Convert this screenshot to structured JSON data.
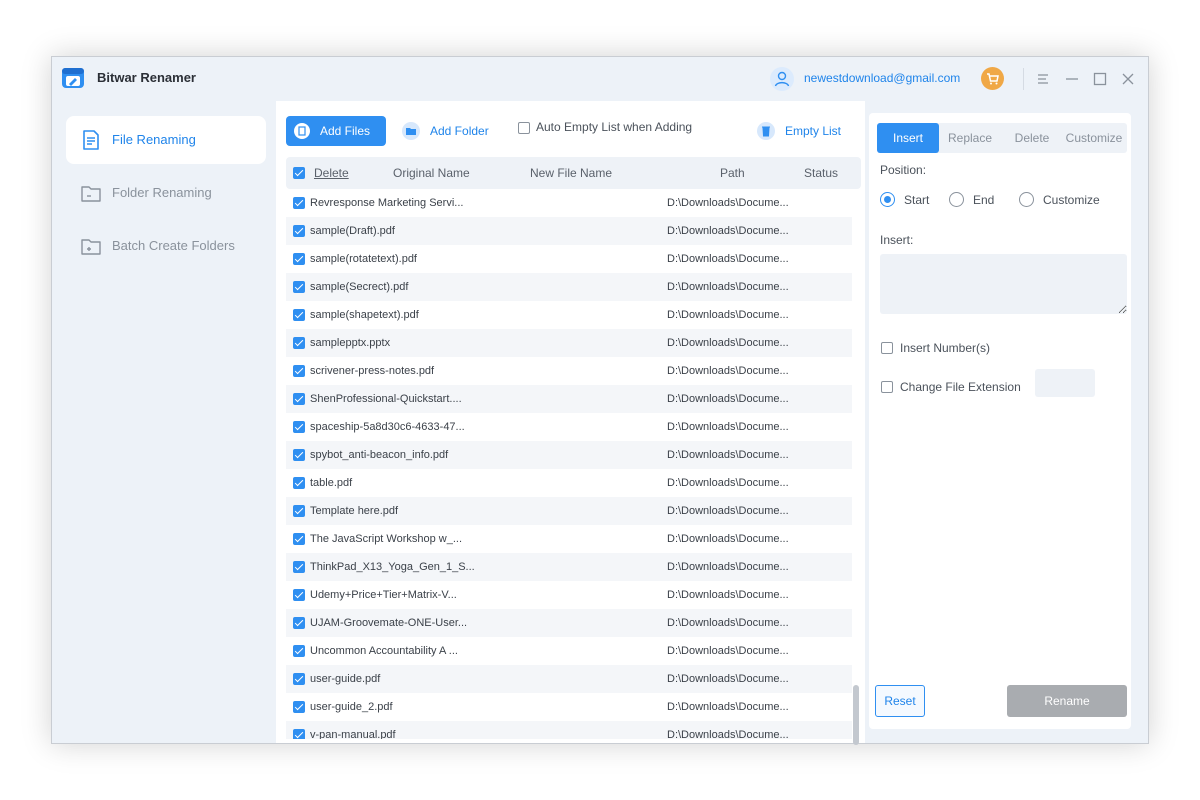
{
  "app": {
    "title": "Bitwar Renamer",
    "user_email": "newestdownload@gmail.com"
  },
  "sidebar": {
    "items": [
      {
        "label": "File Renaming",
        "active": true,
        "icon": "file-icon"
      },
      {
        "label": "Folder Renaming",
        "active": false,
        "icon": "folder-icon"
      },
      {
        "label": "Batch Create Folders",
        "active": false,
        "icon": "folder-plus-icon"
      }
    ]
  },
  "toolbar": {
    "add_files": "Add Files",
    "add_folder": "Add Folder",
    "auto_empty": "Auto Empty List when Adding",
    "auto_empty_checked": false,
    "empty_list": "Empty List"
  },
  "table": {
    "columns": {
      "delete": "Delete",
      "original": "Original Name",
      "new": "New File Name",
      "path": "Path",
      "status": "Status"
    },
    "rows": [
      {
        "name": "Revresponse Marketing Servi...",
        "path": "D:\\Downloads\\Docume..."
      },
      {
        "name": "sample(Draft).pdf",
        "path": "D:\\Downloads\\Docume..."
      },
      {
        "name": "sample(rotatetext).pdf",
        "path": "D:\\Downloads\\Docume..."
      },
      {
        "name": "sample(Secrect).pdf",
        "path": "D:\\Downloads\\Docume..."
      },
      {
        "name": "sample(shapetext).pdf",
        "path": "D:\\Downloads\\Docume..."
      },
      {
        "name": "samplepptx.pptx",
        "path": "D:\\Downloads\\Docume..."
      },
      {
        "name": "scrivener-press-notes.pdf",
        "path": "D:\\Downloads\\Docume..."
      },
      {
        "name": "ShenProfessional-Quickstart....",
        "path": "D:\\Downloads\\Docume..."
      },
      {
        "name": "spaceship-5a8d30c6-4633-47...",
        "path": "D:\\Downloads\\Docume..."
      },
      {
        "name": "spybot_anti-beacon_info.pdf",
        "path": "D:\\Downloads\\Docume..."
      },
      {
        "name": "table.pdf",
        "path": "D:\\Downloads\\Docume..."
      },
      {
        "name": "Template here.pdf",
        "path": "D:\\Downloads\\Docume..."
      },
      {
        "name": "The JavaScript Workshop w_...",
        "path": "D:\\Downloads\\Docume..."
      },
      {
        "name": "ThinkPad_X13_Yoga_Gen_1_S...",
        "path": "D:\\Downloads\\Docume..."
      },
      {
        "name": "Udemy+Price+Tier+Matrix-V...",
        "path": "D:\\Downloads\\Docume..."
      },
      {
        "name": "UJAM-Groovemate-ONE-User...",
        "path": "D:\\Downloads\\Docume..."
      },
      {
        "name": "Uncommon Accountability A ...",
        "path": "D:\\Downloads\\Docume..."
      },
      {
        "name": "user-guide.pdf",
        "path": "D:\\Downloads\\Docume..."
      },
      {
        "name": "user-guide_2.pdf",
        "path": "D:\\Downloads\\Docume..."
      },
      {
        "name": "v-pan-manual.pdf",
        "path": "D:\\Downloads\\Docume..."
      }
    ]
  },
  "panel": {
    "tabs": [
      "Insert",
      "Replace",
      "Delete",
      "Customize"
    ],
    "active_tab": "Insert",
    "position_label": "Position:",
    "positions": [
      "Start",
      "End",
      "Customize"
    ],
    "selected_position": "Start",
    "insert_label": "Insert:",
    "insert_value": "",
    "insert_numbers": "Insert Number(s)",
    "change_ext": "Change File Extension",
    "ext_value": "",
    "reset": "Reset",
    "rename": "Rename"
  },
  "colors": {
    "accent": "#2f8ff1",
    "cart": "#f0a846",
    "sidebar_bg": "#edf2f8",
    "rename_disabled": "#a9acb0"
  }
}
